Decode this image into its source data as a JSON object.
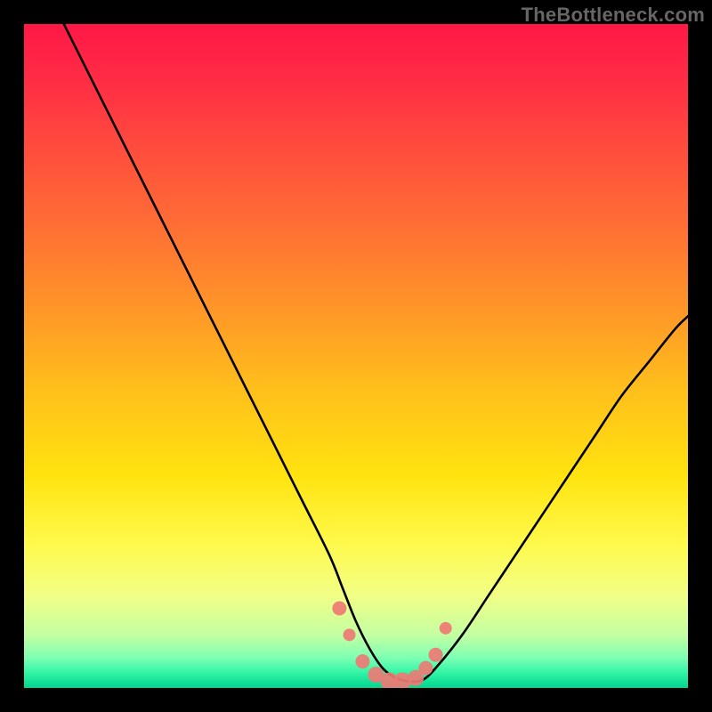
{
  "watermark": "TheBottleneck.com",
  "colors": {
    "frame": "#000000",
    "curve": "#000000",
    "marker_fill": "#ee7a74",
    "marker_stroke": "#ee7a74",
    "gradient_stops": [
      {
        "offset": 0.0,
        "color": "#ff1846"
      },
      {
        "offset": 0.08,
        "color": "#ff2b45"
      },
      {
        "offset": 0.18,
        "color": "#ff4a3e"
      },
      {
        "offset": 0.3,
        "color": "#ff6d35"
      },
      {
        "offset": 0.42,
        "color": "#ff9329"
      },
      {
        "offset": 0.55,
        "color": "#ffbf1c"
      },
      {
        "offset": 0.68,
        "color": "#ffe30f"
      },
      {
        "offset": 0.78,
        "color": "#fff94a"
      },
      {
        "offset": 0.86,
        "color": "#f2ff86"
      },
      {
        "offset": 0.92,
        "color": "#c4ffa2"
      },
      {
        "offset": 0.955,
        "color": "#7dffb3"
      },
      {
        "offset": 0.975,
        "color": "#37f6a7"
      },
      {
        "offset": 1.0,
        "color": "#00d68f"
      }
    ]
  },
  "chart_data": {
    "type": "line",
    "title": "",
    "xlabel": "",
    "ylabel": "",
    "xlim": [
      0,
      100
    ],
    "ylim": [
      0,
      100
    ],
    "series": [
      {
        "name": "bottleneck-curve",
        "x": [
          6,
          10,
          14,
          18,
          22,
          26,
          30,
          34,
          38,
          42,
          46,
          48,
          50,
          52,
          54,
          56,
          58,
          60,
          62,
          66,
          70,
          74,
          78,
          82,
          86,
          90,
          94,
          98,
          100
        ],
        "y": [
          100,
          92,
          84,
          76,
          68,
          60,
          52,
          44,
          36,
          28,
          20,
          15,
          10,
          6,
          3,
          1.5,
          1,
          1.2,
          3,
          8,
          14,
          20,
          26,
          32,
          38,
          44,
          49,
          54,
          56
        ]
      }
    ],
    "markers": {
      "name": "highlight-dots",
      "x": [
        47.5,
        49,
        51,
        53,
        55,
        57,
        59,
        60.5,
        62,
        63.5
      ],
      "y": [
        12,
        8,
        4,
        2,
        1,
        1,
        1.5,
        3,
        5,
        9
      ],
      "r": [
        8,
        7,
        8,
        9,
        10,
        10,
        9,
        8,
        8,
        7
      ]
    }
  }
}
